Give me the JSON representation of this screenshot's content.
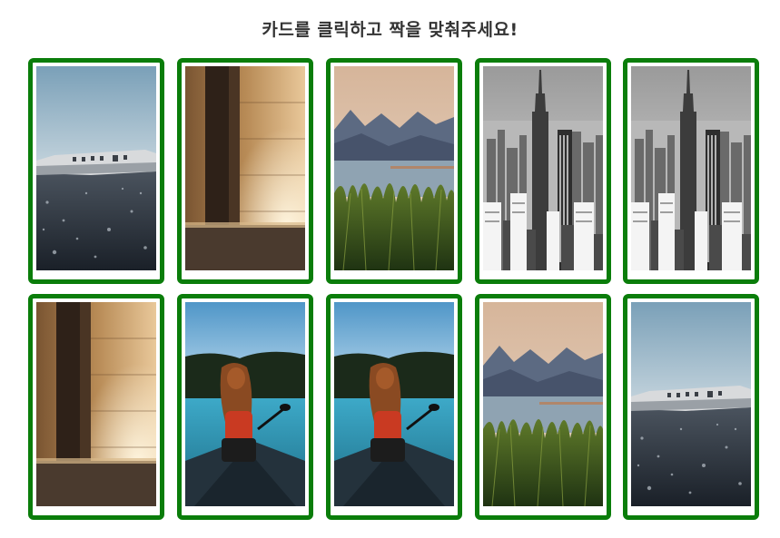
{
  "header": {
    "title": "카드를 클릭하고 짝을 맞춰주세요!"
  },
  "game": {
    "card_border_color": "#0a7d0a",
    "cards": [
      {
        "image": "plane-wreck-image"
      },
      {
        "image": "stone-pillar-image"
      },
      {
        "image": "lake-reeds-image"
      },
      {
        "image": "city-skyline-image"
      },
      {
        "image": "city-skyline-image"
      },
      {
        "image": "stone-pillar-image"
      },
      {
        "image": "canoe-girl-image"
      },
      {
        "image": "canoe-girl-image"
      },
      {
        "image": "lake-reeds-image"
      },
      {
        "image": "plane-wreck-image"
      }
    ]
  }
}
